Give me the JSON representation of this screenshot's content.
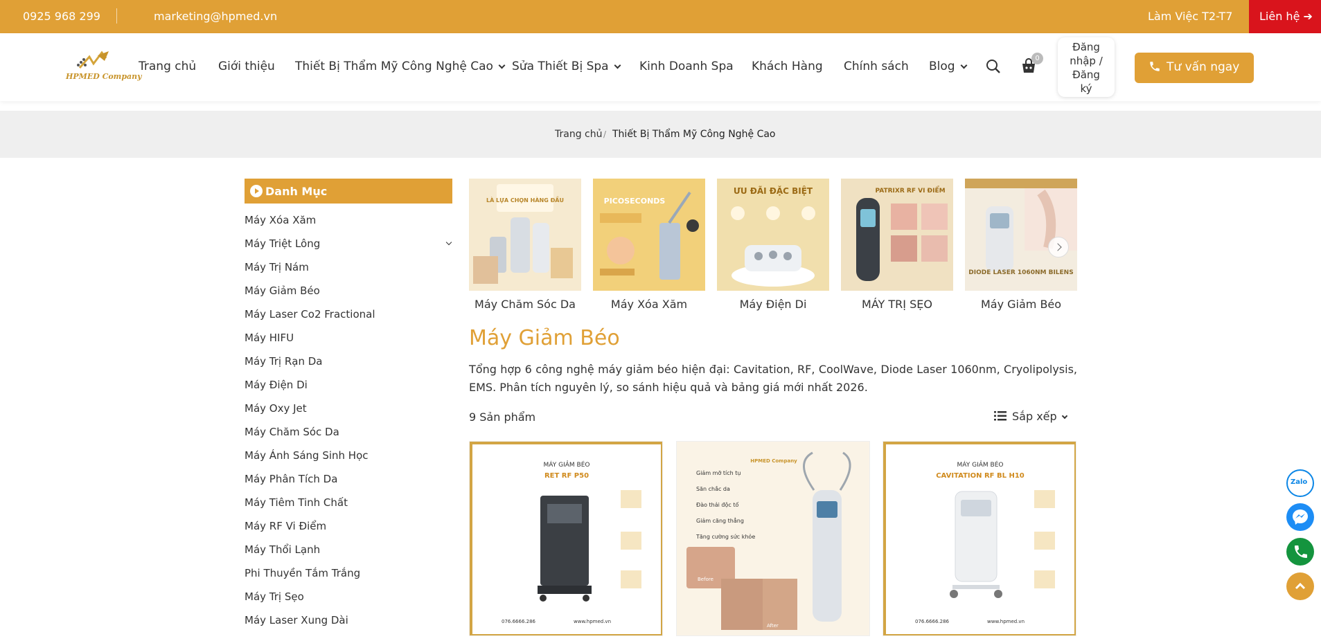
{
  "topbar": {
    "phone": "0925 968 299",
    "email": "marketing@hpmed.vn",
    "hours": "Làm Việc T2-T7",
    "contact": "Liên hệ ➔"
  },
  "header": {
    "logo_text": "HPMED Company",
    "nav": [
      "Trang chủ",
      "Giới thiệu",
      "Thiết Bị Thẩm Mỹ Công Nghệ Cao",
      "Sửa Thiết Bị Spa",
      "Kinh Doanh Spa",
      "Khách Hàng",
      "Chính sách",
      "Blog"
    ],
    "cart_count": "0",
    "login": [
      "Đăng",
      "nhập /",
      "Đăng",
      "ký"
    ],
    "consult": "Tư vấn ngay"
  },
  "breadcrumb": {
    "home": "Trang chủ",
    "separator": "/",
    "current": "Thiết Bị Thẩm Mỹ Công Nghệ Cao"
  },
  "sidebar": {
    "title": "Danh Mục",
    "items": [
      "Máy Xóa Xăm",
      "Máy Triệt Lông",
      "Máy Trị Nám",
      "Máy Giảm Béo",
      "Máy Laser Co2 Fractional",
      "Máy HIFU",
      "Máy Trị Rạn Da",
      "Máy Điện Di",
      "Máy Oxy Jet",
      "Máy Chăm Sóc Da",
      "Máy Ánh Sáng Sinh Học",
      "Máy Phân Tích Da",
      "Máy Tiêm Tinh Chất",
      "Máy RF Vi Điểm",
      "Máy Thổi Lạnh",
      "Phi Thuyền Tắm Trắng",
      "Máy Trị Sẹo",
      "Máy Laser Xung Dài"
    ]
  },
  "categories": [
    {
      "label": "Máy Chăm Sóc Da",
      "banner": "LÀ LỰA CHỌN HÀNG ĐẦU"
    },
    {
      "label": "Máy Xóa Xăm",
      "banner": "PICOSECONDS"
    },
    {
      "label": "Máy Điện Di",
      "banner": "ƯU ĐÃI ĐẶC BIỆT"
    },
    {
      "label": "MÁY TRỊ SẸO",
      "banner": "PATRIXR RF VI ĐIỂM"
    },
    {
      "label": "Máy Giảm Béo",
      "banner": "DIODE LASER 1060NM BILENS"
    }
  ],
  "main": {
    "title": "Máy Giảm Béo",
    "description": "Tổng hợp 6 công nghệ máy giảm béo hiện đại: Cavitation, RF, CoolWave, Diode Laser 1060nm, Cryolipolysis, EMS. Phân tích nguyên lý, so sánh hiệu quả và bảng giá mới nhất 2026.",
    "count": "9 Sản phẩm",
    "sort": "Sắp xếp"
  },
  "products": [
    {
      "kicker": "MÁY GIẢM BÉO",
      "model": "RET RF P50",
      "phone": "076.6666.286",
      "web": "www.hpmed.vn"
    },
    {
      "kicker": "HPMED Company",
      "features": [
        "Giảm mỡ tích tụ",
        "Săn chắc da",
        "Đào thải độc tố",
        "Giảm căng thẳng",
        "Tăng cường sức khỏe"
      ],
      "before": "Before",
      "after": "After"
    },
    {
      "kicker": "MÁY GIẢM BÉO",
      "model": "CAVITATION RF BL H10",
      "phone": "076.6666.286",
      "web": "www.hpmed.vn"
    }
  ],
  "float": {
    "zalo": "Zalo"
  },
  "colors": {
    "accent": "#e0a036",
    "contact": "#d9141c"
  }
}
